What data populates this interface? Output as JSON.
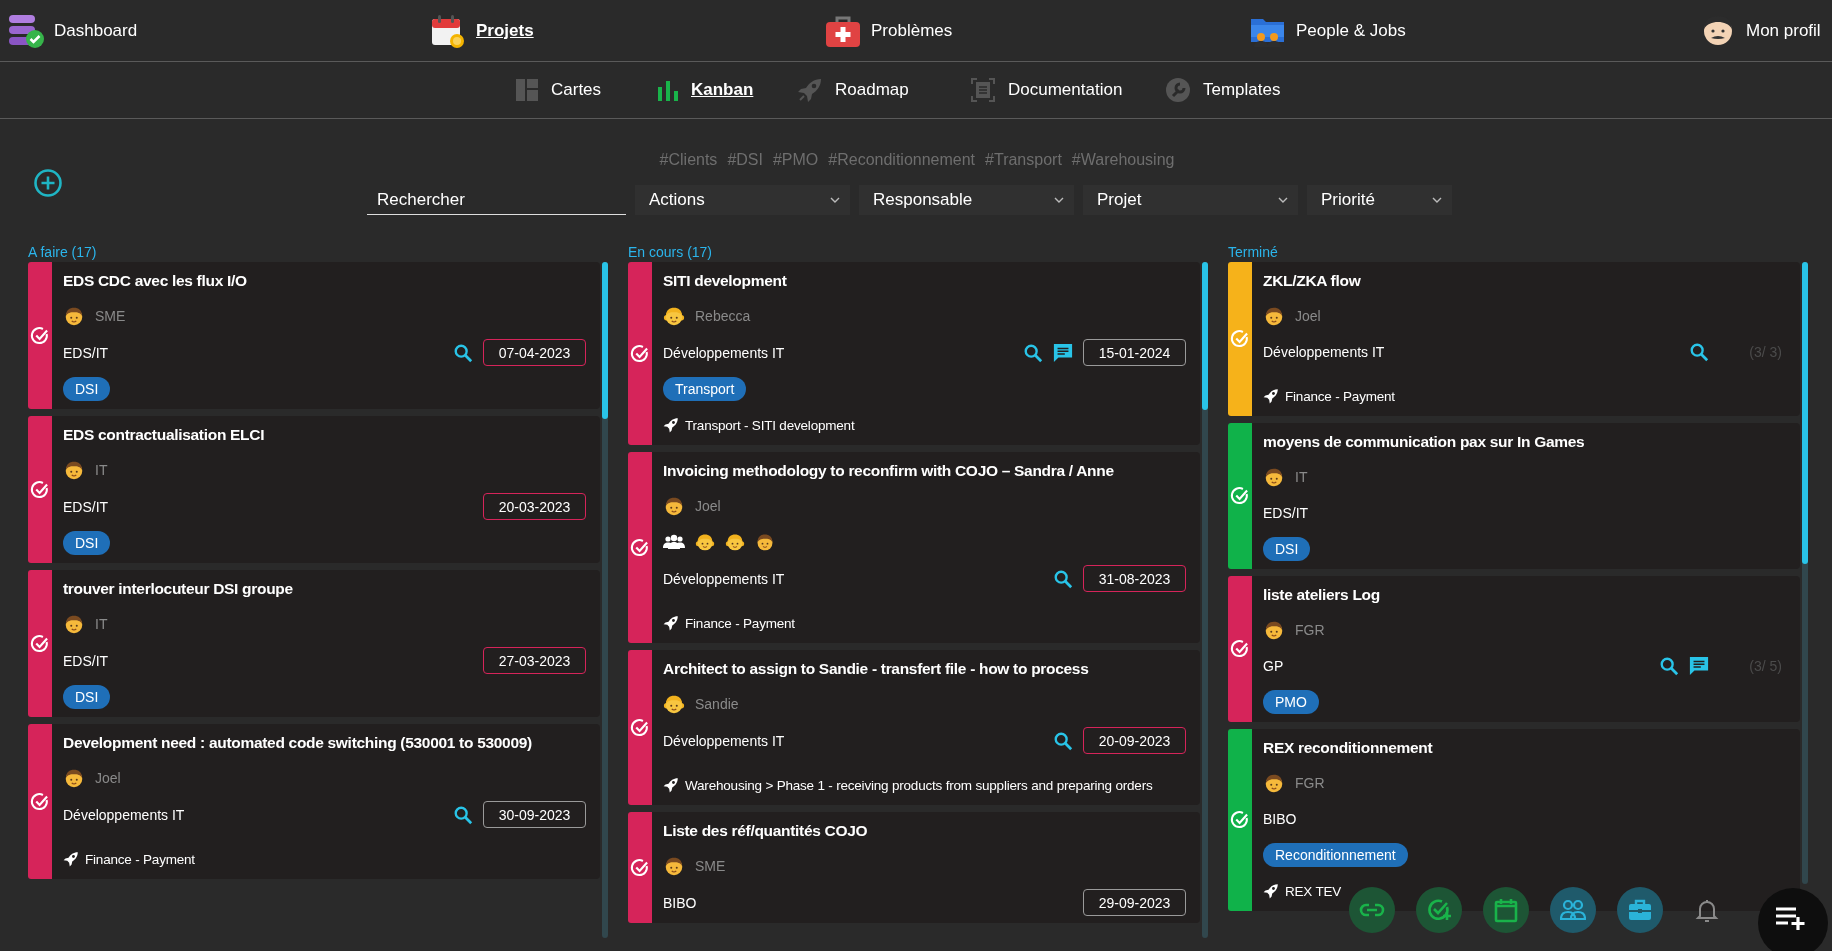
{
  "nav": {
    "items": [
      {
        "label": "Dashboard",
        "selected": false
      },
      {
        "label": "Projets",
        "selected": true
      },
      {
        "label": "Problèmes",
        "selected": false
      },
      {
        "label": "People & Jobs",
        "selected": false
      },
      {
        "label": "Mon profil",
        "selected": false
      }
    ]
  },
  "subnav": {
    "items": [
      {
        "label": "Cartes",
        "selected": false
      },
      {
        "label": "Kanban",
        "selected": true
      },
      {
        "label": "Roadmap",
        "selected": false
      },
      {
        "label": "Documentation",
        "selected": false
      },
      {
        "label": "Templates",
        "selected": false
      }
    ]
  },
  "hashtags": [
    "#Clients",
    "#DSI",
    "#PMO",
    "#Reconditionnement",
    "#Transport",
    "#Warehousing"
  ],
  "filters": {
    "search": {
      "placeholder": "Rechercher"
    },
    "dropdowns": [
      "Actions",
      "Responsable",
      "Projet",
      "Priorité"
    ]
  },
  "columns": [
    {
      "title": "A faire (17)",
      "cards": [
        {
          "title": "EDS CDC avec les flux I/O",
          "color": "#d6245a",
          "assignee": {
            "name": "SME",
            "kind": "boy"
          },
          "group": "EDS/IT",
          "search": true,
          "comments": false,
          "date": {
            "text": "07-04-2023",
            "overdue": true
          },
          "tag": "DSI"
        },
        {
          "title": "EDS contractualisation ELCI",
          "color": "#d6245a",
          "assignee": {
            "name": "IT",
            "kind": "boy"
          },
          "group": "EDS/IT",
          "search": false,
          "comments": false,
          "date": {
            "text": "20-03-2023",
            "overdue": true
          },
          "tag": "DSI"
        },
        {
          "title": "trouver interlocuteur DSI groupe",
          "color": "#d6245a",
          "assignee": {
            "name": "IT",
            "kind": "boy"
          },
          "group": "EDS/IT",
          "search": false,
          "comments": false,
          "date": {
            "text": "27-03-2023",
            "overdue": true
          },
          "tag": "DSI"
        },
        {
          "title": "Development need : automated code switching (530001 to 530009)",
          "color": "#d6245a",
          "assignee": {
            "name": "Joel",
            "kind": "boy"
          },
          "group": "Développements IT",
          "search": true,
          "comments": false,
          "date": {
            "text": "30-09-2023",
            "overdue": false
          },
          "project": "Finance - Payment"
        }
      ]
    },
    {
      "title": "En cours (17)",
      "cards": [
        {
          "title": "SITI development",
          "color": "#d6245a",
          "assignee": {
            "name": "Rebecca",
            "kind": "girl"
          },
          "group": "Développements IT",
          "search": true,
          "comments": true,
          "date": {
            "text": "15-01-2024",
            "overdue": false
          },
          "tag": "Transport",
          "project": "Transport - SITI development"
        },
        {
          "title": "Invoicing methodology to reconfirm with COJO – Sandra / Anne",
          "color": "#d6245a",
          "assignee": {
            "name": "Joel",
            "kind": "boy"
          },
          "participants": [
            {
              "kind": "girl"
            },
            {
              "kind": "girl"
            },
            {
              "kind": "boy"
            }
          ],
          "group": "Développements IT",
          "search": true,
          "comments": false,
          "date": {
            "text": "31-08-2023",
            "overdue": true
          },
          "project": "Finance - Payment"
        },
        {
          "title": "Architect to assign to Sandie - transfert file - how to process",
          "color": "#d6245a",
          "assignee": {
            "name": "Sandie",
            "kind": "girl"
          },
          "group": "Développements IT",
          "search": true,
          "comments": false,
          "date": {
            "text": "20-09-2023",
            "overdue": true
          },
          "project": "Warehousing > Phase 1 - receiving products from suppliers and preparing orders"
        },
        {
          "title": "Liste des réf/quantités COJO",
          "color": "#d6245a",
          "assignee": {
            "name": "SME",
            "kind": "boy"
          },
          "group": "BIBO",
          "search": false,
          "comments": false,
          "date": {
            "text": "29-09-2023",
            "overdue": false
          }
        }
      ]
    },
    {
      "title": "Terminé",
      "cards": [
        {
          "title": "ZKL/ZKA flow",
          "color": "#f6b21a",
          "assignee": {
            "name": "Joel",
            "kind": "boy"
          },
          "group": "Développements IT",
          "search": true,
          "comments": false,
          "progress": "(3/ 3)",
          "project": "Finance - Payment"
        },
        {
          "title": "moyens de communication pax sur In Games",
          "color": "#10b24a",
          "assignee": {
            "name": "IT",
            "kind": "boy"
          },
          "group": "EDS/IT",
          "search": false,
          "comments": false,
          "tag": "DSI"
        },
        {
          "title": "liste ateliers Log",
          "color": "#d6245a",
          "assignee": {
            "name": "FGR",
            "kind": "boy"
          },
          "group": "GP",
          "search": true,
          "comments": true,
          "progress": "(3/ 5)",
          "tag": "PMO"
        },
        {
          "title": "REX reconditionnement",
          "color": "#10b24a",
          "assignee": {
            "name": "FGR",
            "kind": "boy"
          },
          "group": "BIBO",
          "search": false,
          "comments": false,
          "tag": "Reconditionnement",
          "project": "REX TEV"
        }
      ]
    }
  ]
}
